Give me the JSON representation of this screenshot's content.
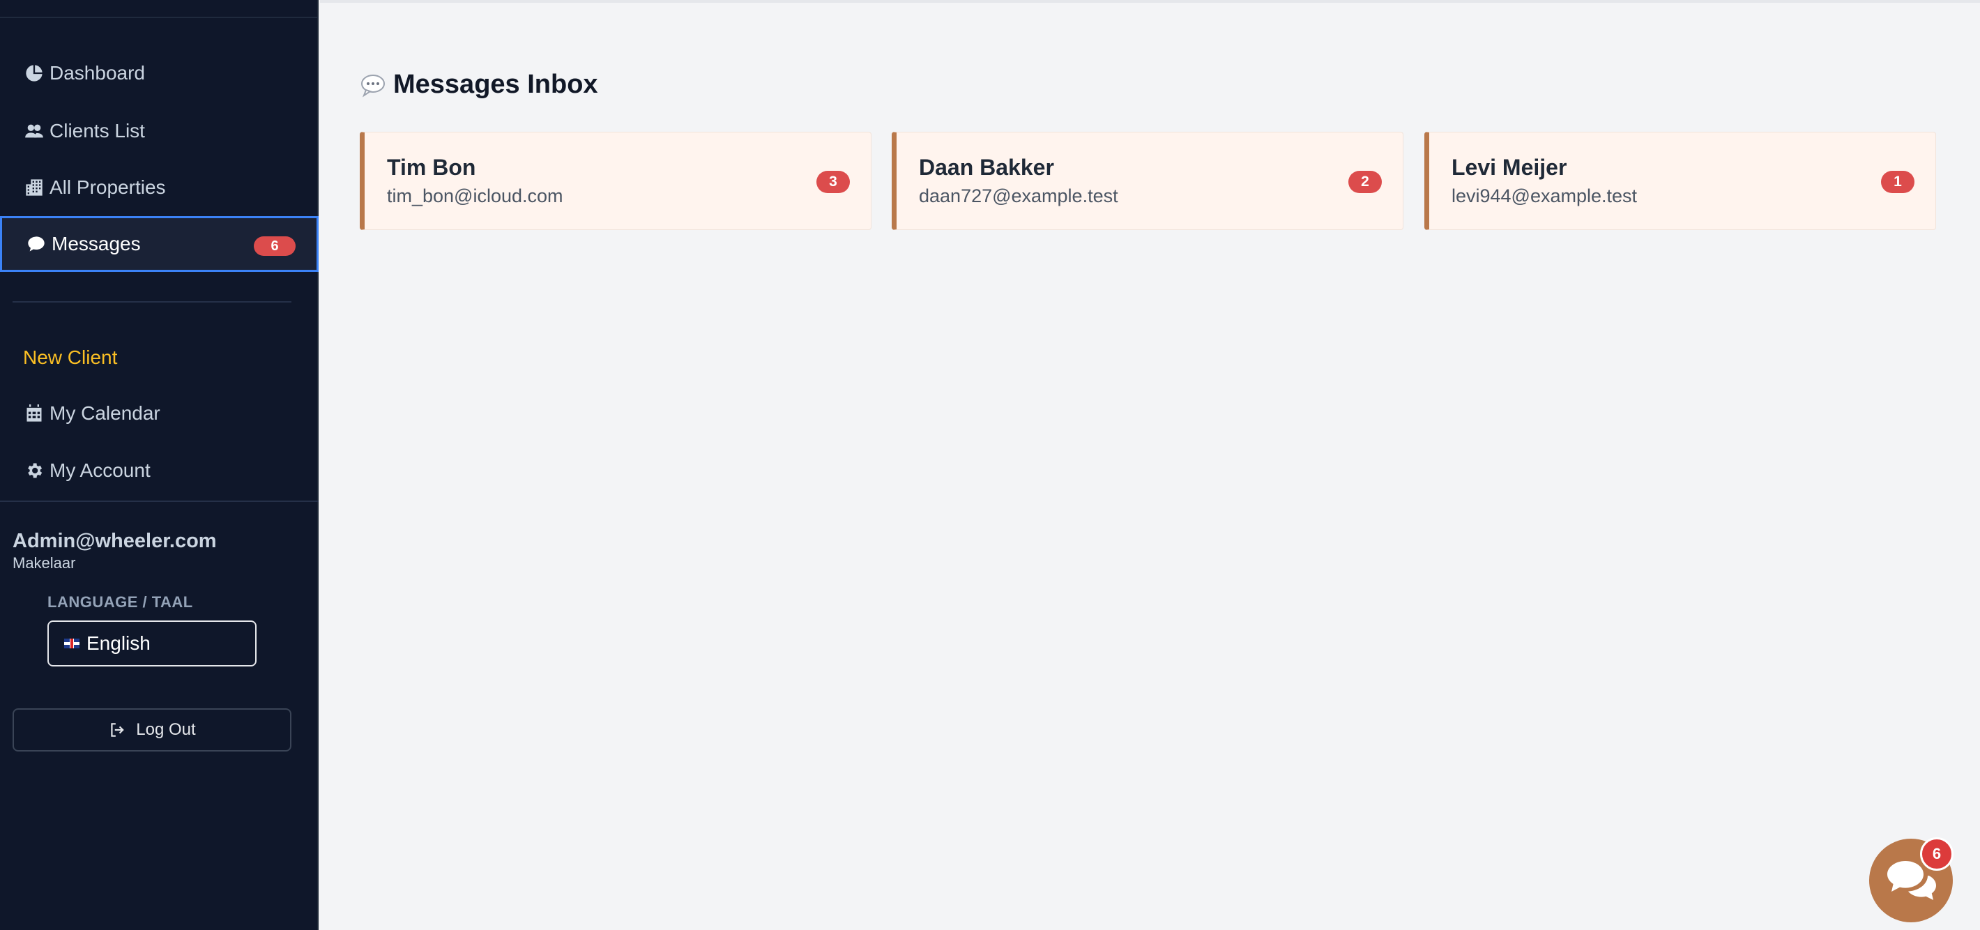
{
  "sidebar": {
    "nav": [
      {
        "label": "Dashboard",
        "icon": "pie-chart-icon"
      },
      {
        "label": "Clients List",
        "icon": "users-icon"
      },
      {
        "label": "All Properties",
        "icon": "building-icon"
      },
      {
        "label": "Messages",
        "icon": "chat-bubble-icon",
        "badge": "6",
        "active": true
      }
    ],
    "secondary": [
      {
        "label": "New Client"
      },
      {
        "label": "My Calendar",
        "icon": "calendar-icon"
      },
      {
        "label": "My Account",
        "icon": "gear-icon"
      }
    ],
    "user": {
      "email": "Admin@wheeler.com",
      "role": "Makelaar"
    },
    "language": {
      "label": "LANGUAGE / TAAL",
      "selected": "English",
      "flag_icon": "uk-flag-icon"
    },
    "logout_label": "Log Out"
  },
  "main": {
    "title": "Messages Inbox",
    "title_icon": "speech-balloon-icon",
    "conversations": [
      {
        "name": "Tim Bon",
        "email": "tim_bon@icloud.com",
        "unread": "3"
      },
      {
        "name": "Daan Bakker",
        "email": "daan727@example.test",
        "unread": "2"
      },
      {
        "name": "Levi Meijer",
        "email": "levi944@example.test",
        "unread": "1"
      }
    ]
  },
  "chat_widget": {
    "badge": "6",
    "icon": "chat-bubbles-icon"
  },
  "colors": {
    "sidebar_bg": "#0f172a",
    "accent_brown": "#b9784a",
    "badge_red": "#dc4c4c",
    "new_client_yellow": "#fbbf24",
    "active_border": "#3b82f6"
  }
}
